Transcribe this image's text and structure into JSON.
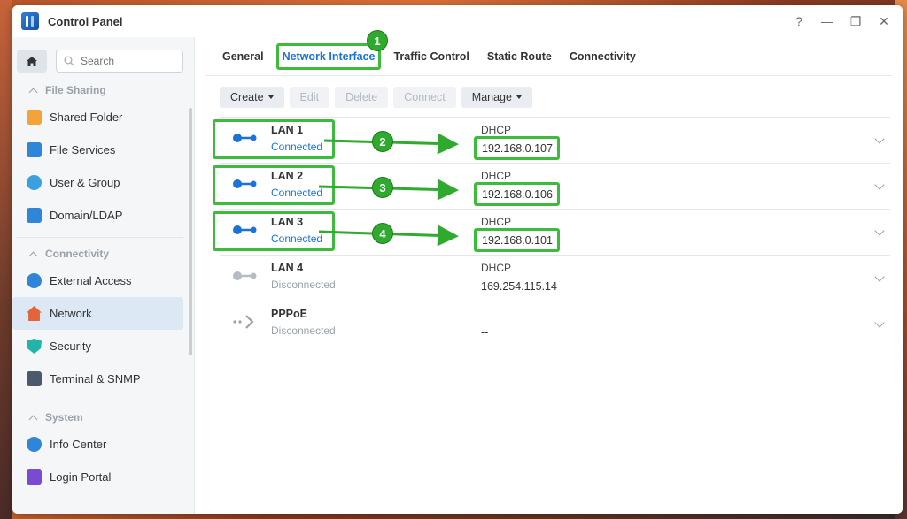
{
  "window": {
    "title": "Control Panel",
    "controls": {
      "help": "?",
      "minimize": "—",
      "maximize": "❐",
      "close": "✕"
    }
  },
  "sidebar": {
    "search_placeholder": "Search",
    "sections": [
      {
        "label": "File Sharing",
        "items": [
          {
            "label": "Shared Folder",
            "icon": "folder-icon",
            "color": "#f2a33a"
          },
          {
            "label": "File Services",
            "icon": "file-services-icon",
            "color": "#2f86d9"
          },
          {
            "label": "User & Group",
            "icon": "users-icon",
            "color": "#3aa0e0"
          },
          {
            "label": "Domain/LDAP",
            "icon": "domain-icon",
            "color": "#2f86d9"
          }
        ]
      },
      {
        "label": "Connectivity",
        "items": [
          {
            "label": "External Access",
            "icon": "external-access-icon",
            "color": "#2f86d9"
          },
          {
            "label": "Network",
            "icon": "network-house-icon",
            "color": "#e2643a",
            "active": true
          },
          {
            "label": "Security",
            "icon": "shield-icon",
            "color": "#23b3a8"
          },
          {
            "label": "Terminal & SNMP",
            "icon": "terminal-icon",
            "color": "#4a5a6a"
          }
        ]
      },
      {
        "label": "System",
        "items": [
          {
            "label": "Info Center",
            "icon": "info-icon",
            "color": "#2f86d9"
          },
          {
            "label": "Login Portal",
            "icon": "login-portal-icon",
            "color": "#7a4ad0"
          }
        ]
      }
    ]
  },
  "tabs": [
    "General",
    "Network Interface",
    "Traffic Control",
    "Static Route",
    "Connectivity"
  ],
  "active_tab": "Network Interface",
  "toolbar": {
    "create": "Create",
    "edit": "Edit",
    "delete": "Delete",
    "connect": "Connect",
    "manage": "Manage"
  },
  "interfaces": [
    {
      "name": "LAN 1",
      "status": "Connected",
      "mode": "DHCP",
      "ip": "192.168.0.107"
    },
    {
      "name": "LAN 2",
      "status": "Connected",
      "mode": "DHCP",
      "ip": "192.168.0.106"
    },
    {
      "name": "LAN 3",
      "status": "Connected",
      "mode": "DHCP",
      "ip": "192.168.0.101"
    },
    {
      "name": "LAN 4",
      "status": "Disconnected",
      "mode": "DHCP",
      "ip": "169.254.115.14"
    },
    {
      "name": "PPPoE",
      "status": "Disconnected",
      "mode": "",
      "ip": "--"
    }
  ],
  "annotations": {
    "badges": [
      "1",
      "2",
      "3",
      "4"
    ],
    "highlight_color": "#3cbb3c"
  }
}
